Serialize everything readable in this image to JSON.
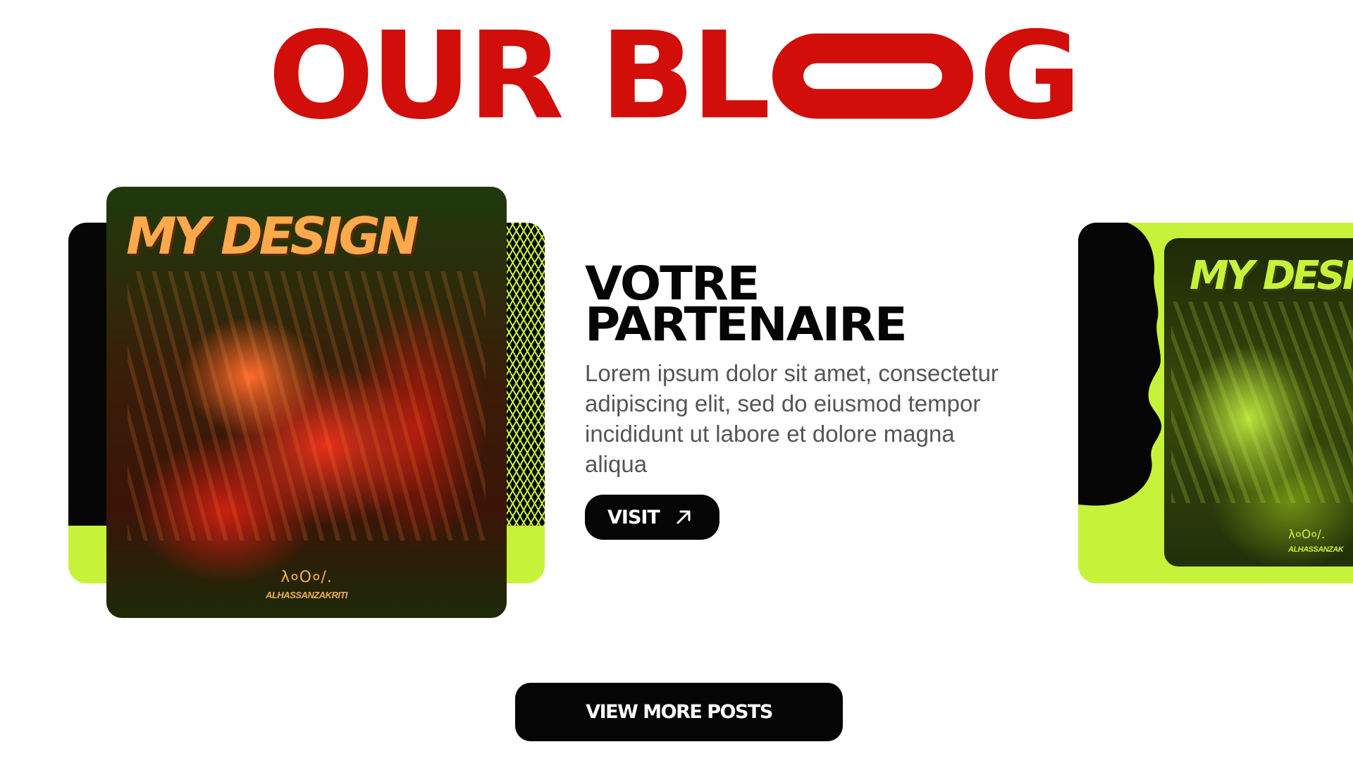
{
  "header": {
    "title_part1": "OUR BL",
    "title_part2": "G"
  },
  "featured_post": {
    "image_headline": "MY DESIGN",
    "image_signature_mark": "λ०O०/.",
    "image_signature_name": "ALHASSANZAKRITI",
    "title_line1": "VOTRE",
    "title_line2": "PARTENAIRE",
    "excerpt": "Lorem ipsum dolor sit amet, consectetur adipiscing elit, sed do eiusmod tempor incididunt ut labore et dolore magna aliqua",
    "visit_label": "VISIT",
    "visit_icon": "arrow-up-right-icon"
  },
  "next_post_preview": {
    "image_headline": "MY DESIG",
    "image_signature_mark": "λ०O०/.",
    "image_signature_name": "ALHASSANZAK"
  },
  "footer": {
    "view_more_label": "VIEW MORE POSTS"
  },
  "colors": {
    "title_red": "#d10e0a",
    "accent_lime": "#c7f23a",
    "button_black": "#050505",
    "body_text": "#555555"
  }
}
